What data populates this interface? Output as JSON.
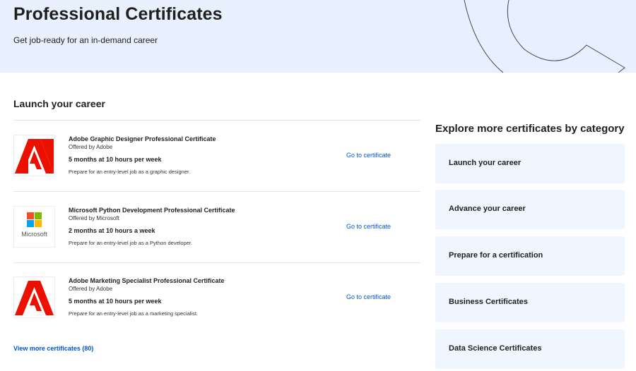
{
  "hero": {
    "title": "Professional Certificates",
    "subtitle": "Get job-ready for an in-demand career"
  },
  "main": {
    "section_title": "Launch your career",
    "certificates": [
      {
        "title": "Adobe Graphic Designer Professional Certificate",
        "offered_by": "Offered by Adobe",
        "duration": "5 months at 10 hours per week",
        "description": "Prepare for an entry-level job as a graphic designer.",
        "link": "Go to certificate",
        "logo": "adobe-logo"
      },
      {
        "title": "Microsoft Python Development Professional Certificate",
        "offered_by": "Offered by Microsoft",
        "duration": "2 months at 10 hours a week",
        "description": "Prepare for an entry-level job as a Python developer.",
        "link": "Go to certificate",
        "logo": "microsoft-logo",
        "logo_text": "Microsoft"
      },
      {
        "title": "Adobe Marketing Specialist Professional Certificate",
        "offered_by": "Offered by Adobe",
        "duration": "5 months at 10 hours per week",
        "description": "Prepare for an entry-level job as a marketing specialist.",
        "link": "Go to certificate",
        "logo": "adobe-logo"
      }
    ],
    "view_more": "View more certificates (80)"
  },
  "sidebar": {
    "title": "Explore more certificates by category",
    "categories": [
      "Launch your career",
      "Advance your career",
      "Prepare for a certification",
      "Business Certificates",
      "Data Science Certificates"
    ]
  },
  "colors": {
    "hero_bg": "#e8f0fd",
    "link": "#0056d2",
    "adobe_red": "#eb1000",
    "category_bg": "#f0f6ff"
  }
}
